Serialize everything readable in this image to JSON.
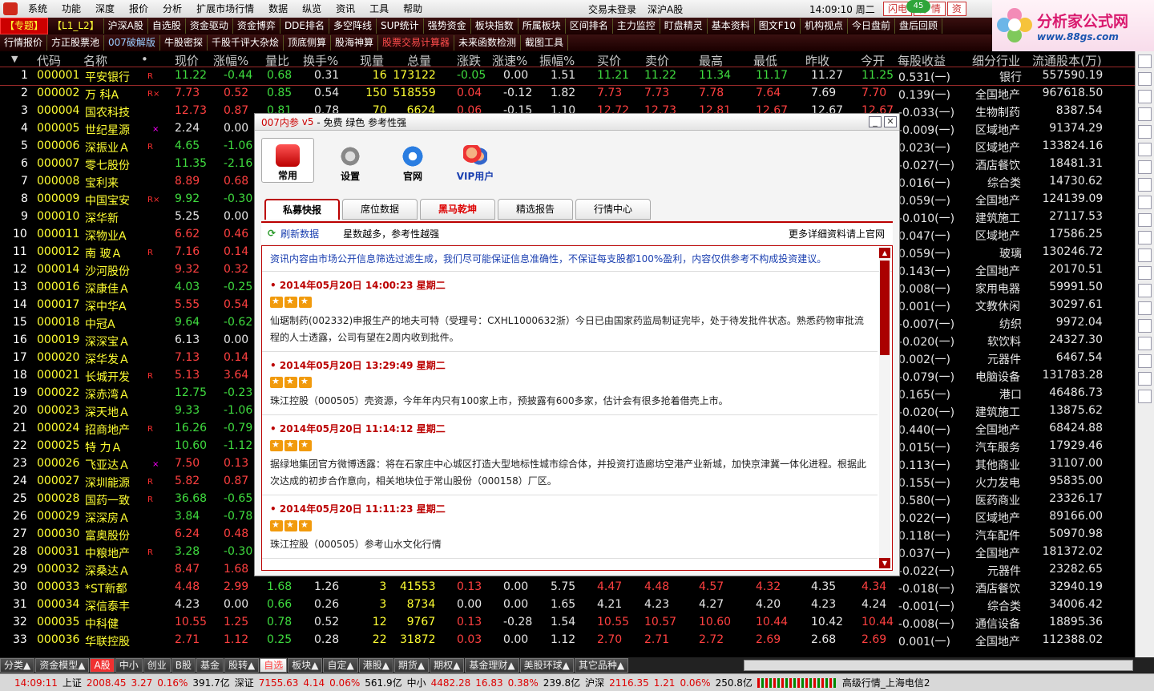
{
  "menubar": {
    "items": [
      "系统",
      "功能",
      "深度",
      "报价",
      "分析",
      "扩展市场行情",
      "数据",
      "纵览",
      "资讯",
      "工具",
      "帮助"
    ],
    "login_status": "交易未登录",
    "market": "深沪A股",
    "clock": "14:09:10 周二",
    "badge": "45",
    "win_buttons": [
      "闪电",
      "行 情",
      "资"
    ]
  },
  "brand": {
    "title": "分析家公式网",
    "url": "www.88gs.com"
  },
  "toolbar1": [
    "【专题】",
    "【L1_L2】",
    "沪深A股",
    "自选股",
    "资金驱动",
    "资金博弈",
    "DDE排名",
    "多空阵线",
    "SUP统计",
    "强势资金",
    "板块指数",
    "所属板块",
    "区间排名",
    "主力监控",
    "盯盘精灵",
    "基本资料",
    "图文F10",
    "机构视点",
    "今日盘前",
    "盘后回顾"
  ],
  "toolbar2": [
    "行情报价",
    "方正股票池",
    "007破解版",
    "牛股密探",
    "千股千评大杂烩",
    "顶底侧算",
    "股海神算",
    "股票交易计算器",
    "未来函数检测",
    "截图工具"
  ],
  "columns": [
    "代码",
    "名称",
    "•",
    "现价",
    "涨幅%",
    "量比",
    "换手%",
    "现量",
    "总量",
    "涨跌",
    "涨速%",
    "振幅%",
    "买价",
    "卖价",
    "最高",
    "最低",
    "昨收",
    "今开",
    "每股收益",
    "细分行业",
    "流通股本(万)"
  ],
  "rows": [
    {
      "i": "1",
      "code": "000001",
      "name": "平安银行",
      "m": "R",
      "price": "11.22",
      "chg": "-0.44",
      "vr": "0.68",
      "turn": "0.31",
      "cur": "16",
      "vol": "173122",
      "d": "-0.05",
      "spd": "0.00",
      "amp": "1.51",
      "bid": "11.21",
      "ask": "11.22",
      "hi": "11.34",
      "lo": "11.17",
      "pre": "11.27",
      "open": "11.25",
      "eps": "0.531(一)",
      "ind": "银行",
      "cap": "557590.19"
    },
    {
      "i": "2",
      "code": "000002",
      "name": "万  科A",
      "m": "R×",
      "price": "7.73",
      "chg": "0.52",
      "vr": "0.85",
      "turn": "0.54",
      "cur": "150",
      "vol": "518559",
      "d": "0.04",
      "spd": "-0.12",
      "amp": "1.82",
      "bid": "7.73",
      "ask": "7.73",
      "hi": "7.78",
      "lo": "7.64",
      "pre": "7.69",
      "open": "7.70",
      "eps": "0.139(一)",
      "ind": "全国地产",
      "cap": "967618.50"
    },
    {
      "i": "3",
      "code": "000004",
      "name": "国农科技",
      "m": "",
      "price": "12.73",
      "chg": "0.87",
      "vr": "0.81",
      "turn": "0.78",
      "cur": "70",
      "vol": "6624",
      "d": "0.06",
      "spd": "-0.15",
      "amp": "1.10",
      "bid": "12.72",
      "ask": "12.73",
      "hi": "12.81",
      "lo": "12.67",
      "pre": "12.67",
      "open": "12.67",
      "eps": "-0.033(一)",
      "ind": "生物制药",
      "cap": "8387.54"
    },
    {
      "i": "4",
      "code": "000005",
      "name": "世纪星源",
      "m": "×",
      "price": "2.24",
      "chg": "0.00",
      "eps": "-0.009(一)",
      "ind": "区域地产",
      "cap": "91374.29"
    },
    {
      "i": "5",
      "code": "000006",
      "name": "深振业Ａ",
      "m": "R",
      "price": "4.65",
      "chg": "-1.06",
      "eps": "0.023(一)",
      "ind": "区域地产",
      "cap": "133824.16"
    },
    {
      "i": "6",
      "code": "000007",
      "name": "零七股份",
      "m": "",
      "price": "11.35",
      "chg": "-2.16",
      "eps": "-0.027(一)",
      "ind": "酒店餐饮",
      "cap": "18481.31"
    },
    {
      "i": "7",
      "code": "000008",
      "name": "宝利来",
      "m": "",
      "price": "8.89",
      "chg": "0.68",
      "eps": "0.016(一)",
      "ind": "综合类",
      "cap": "14730.62"
    },
    {
      "i": "8",
      "code": "000009",
      "name": "中国宝安",
      "m": "R×",
      "price": "9.92",
      "chg": "-0.30",
      "eps": "0.059(一)",
      "ind": "全国地产",
      "cap": "124139.09"
    },
    {
      "i": "9",
      "code": "000010",
      "name": "深华新",
      "m": "",
      "price": "5.25",
      "chg": "0.00",
      "eps": "-0.010(一)",
      "ind": "建筑施工",
      "cap": "27117.53"
    },
    {
      "i": "10",
      "code": "000011",
      "name": "深物业A",
      "m": "",
      "price": "6.62",
      "chg": "0.46",
      "eps": "0.047(一)",
      "ind": "区域地产",
      "cap": "17586.25"
    },
    {
      "i": "11",
      "code": "000012",
      "name": "南  玻Ａ",
      "m": "R",
      "price": "7.16",
      "chg": "0.14",
      "eps": "0.059(一)",
      "ind": "玻璃",
      "cap": "130246.72"
    },
    {
      "i": "12",
      "code": "000014",
      "name": "沙河股份",
      "m": "",
      "price": "9.32",
      "chg": "0.32",
      "eps": "0.143(一)",
      "ind": "全国地产",
      "cap": "20170.51"
    },
    {
      "i": "13",
      "code": "000016",
      "name": "深康佳Ａ",
      "m": "",
      "price": "4.03",
      "chg": "-0.25",
      "eps": "0.008(一)",
      "ind": "家用电器",
      "cap": "59991.50"
    },
    {
      "i": "14",
      "code": "000017",
      "name": "深中华A",
      "m": "",
      "price": "5.55",
      "chg": "0.54",
      "eps": "0.001(一)",
      "ind": "文教休闲",
      "cap": "30297.61"
    },
    {
      "i": "15",
      "code": "000018",
      "name": "中冠A",
      "m": "",
      "price": "9.64",
      "chg": "-0.62",
      "eps": "-0.007(一)",
      "ind": "纺织",
      "cap": "9972.04"
    },
    {
      "i": "16",
      "code": "000019",
      "name": "深深宝Ａ",
      "m": "",
      "price": "6.13",
      "chg": "0.00",
      "eps": "-0.020(一)",
      "ind": "软饮料",
      "cap": "24327.30"
    },
    {
      "i": "17",
      "code": "000020",
      "name": "深华发Ａ",
      "m": "",
      "price": "7.13",
      "chg": "0.14",
      "eps": "0.002(一)",
      "ind": "元器件",
      "cap": "6467.54"
    },
    {
      "i": "18",
      "code": "000021",
      "name": "长城开发",
      "m": "R",
      "price": "5.13",
      "chg": "3.64",
      "eps": "-0.079(一)",
      "ind": "电脑设备",
      "cap": "131783.28"
    },
    {
      "i": "19",
      "code": "000022",
      "name": "深赤湾Ａ",
      "m": "",
      "price": "12.75",
      "chg": "-0.23",
      "eps": "0.165(一)",
      "ind": "港口",
      "cap": "46486.73"
    },
    {
      "i": "20",
      "code": "000023",
      "name": "深天地Ａ",
      "m": "",
      "price": "9.33",
      "chg": "-1.06",
      "eps": "-0.020(一)",
      "ind": "建筑施工",
      "cap": "13875.62"
    },
    {
      "i": "21",
      "code": "000024",
      "name": "招商地产",
      "m": "R",
      "price": "16.26",
      "chg": "-0.79",
      "eps": "0.440(一)",
      "ind": "全国地产",
      "cap": "68424.88"
    },
    {
      "i": "22",
      "code": "000025",
      "name": "特  力Ａ",
      "m": "",
      "price": "10.60",
      "chg": "-1.12",
      "eps": "0.015(一)",
      "ind": "汽车服务",
      "cap": "17929.46"
    },
    {
      "i": "23",
      "code": "000026",
      "name": "飞亚达Ａ",
      "m": "×",
      "price": "7.50",
      "chg": "0.13",
      "eps": "0.113(一)",
      "ind": "其他商业",
      "cap": "31107.00"
    },
    {
      "i": "24",
      "code": "000027",
      "name": "深圳能源",
      "m": "R",
      "price": "5.82",
      "chg": "0.87",
      "eps": "0.155(一)",
      "ind": "火力发电",
      "cap": "95835.00"
    },
    {
      "i": "25",
      "code": "000028",
      "name": "国药一致",
      "m": "R",
      "price": "36.68",
      "chg": "-0.65",
      "eps": "0.580(一)",
      "ind": "医药商业",
      "cap": "23326.17"
    },
    {
      "i": "26",
      "code": "000029",
      "name": "深深房Ａ",
      "m": "",
      "price": "3.84",
      "chg": "-0.78",
      "eps": "0.022(一)",
      "ind": "区域地产",
      "cap": "89166.00"
    },
    {
      "i": "27",
      "code": "000030",
      "name": "富奥股份",
      "m": "",
      "price": "6.24",
      "chg": "0.48",
      "eps": "0.118(一)",
      "ind": "汽车配件",
      "cap": "50970.98"
    },
    {
      "i": "28",
      "code": "000031",
      "name": "中粮地产",
      "m": "R",
      "price": "3.28",
      "chg": "-0.30",
      "eps": "0.037(一)",
      "ind": "全国地产",
      "cap": "181372.02"
    },
    {
      "i": "29",
      "code": "000032",
      "name": "深桑达Ａ",
      "m": "",
      "price": "8.47",
      "chg": "1.68",
      "eps": "-0.022(一)",
      "ind": "元器件",
      "cap": "23282.65"
    },
    {
      "i": "30",
      "code": "000033",
      "name": "*ST新都",
      "m": "",
      "price": "4.48",
      "chg": "2.99",
      "vr": "1.68",
      "turn": "1.26",
      "cur": "3",
      "vol": "41553",
      "d": "0.13",
      "spd": "0.00",
      "amp": "5.75",
      "bid": "4.47",
      "ask": "4.48",
      "hi": "4.57",
      "lo": "4.32",
      "pre": "4.35",
      "open": "4.34",
      "eps": "-0.018(一)",
      "ind": "酒店餐饮",
      "cap": "32940.19"
    },
    {
      "i": "31",
      "code": "000034",
      "name": "深信泰丰",
      "m": "",
      "price": "4.23",
      "chg": "0.00",
      "vr": "0.66",
      "turn": "0.26",
      "cur": "3",
      "vol": "8734",
      "d": "0.00",
      "spd": "0.00",
      "amp": "1.65",
      "bid": "4.21",
      "ask": "4.23",
      "hi": "4.27",
      "lo": "4.20",
      "pre": "4.23",
      "open": "4.24",
      "eps": "-0.001(一)",
      "ind": "综合类",
      "cap": "34006.42"
    },
    {
      "i": "32",
      "code": "000035",
      "name": "中科健",
      "m": "",
      "price": "10.55",
      "chg": "1.25",
      "vr": "0.78",
      "turn": "0.52",
      "cur": "12",
      "vol": "9767",
      "d": "0.13",
      "spd": "-0.28",
      "amp": "1.54",
      "bid": "10.55",
      "ask": "10.57",
      "hi": "10.60",
      "lo": "10.44",
      "pre": "10.42",
      "open": "10.44",
      "eps": "-0.008(一)",
      "ind": "通信设备",
      "cap": "18895.36"
    },
    {
      "i": "33",
      "code": "000036",
      "name": "华联控股",
      "m": "",
      "price": "2.71",
      "chg": "1.12",
      "vr": "0.25",
      "turn": "0.28",
      "cur": "22",
      "vol": "31872",
      "d": "0.03",
      "spd": "0.00",
      "amp": "1.12",
      "bid": "2.70",
      "ask": "2.71",
      "hi": "2.72",
      "lo": "2.69",
      "pre": "2.68",
      "open": "2.69",
      "eps": "0.001(一)",
      "ind": "全国地产",
      "cap": "112388.02"
    }
  ],
  "bottom_tabs": [
    "分类▲",
    "资金模型▲",
    "A股",
    "中小",
    "创业",
    "B股",
    "基金",
    "股转▲",
    "自选",
    "板块▲",
    "自定▲",
    "港股▲",
    "期货▲",
    "期权▲",
    "基金理财▲",
    "美股环球▲",
    "其它品种▲"
  ],
  "statusbar": {
    "time": "14:09:11",
    "sh_label": "上证",
    "sh": "2008.45",
    "sh_chg": "3.27",
    "sh_pct": "0.16%",
    "sh_amt": "391.7亿",
    "sz_label": "深证",
    "sz": "7155.63",
    "sz_chg": "4.14",
    "sz_pct": "0.06%",
    "sz_amt": "561.9亿",
    "zx_label": "中小",
    "zx": "4482.28",
    "zx_chg": "16.83",
    "zx_pct": "0.38%",
    "zx_amt": "239.8亿",
    "hs_label": "沪深",
    "hs": "2116.35",
    "hs_chg": "1.21",
    "hs_pct": "0.06%",
    "hs_amt": "250.8亿",
    "right": "高级行情_上海电信2"
  },
  "dialog": {
    "title": "007内参",
    "version": "v5",
    "subtitle": "- 免费 绿色 参考性强",
    "icons": [
      "常用",
      "设置",
      "官网",
      "VIP用户"
    ],
    "tabs": [
      "私募快报",
      "席位数据",
      "黑马乾坤",
      "精选报告",
      "行情中心"
    ],
    "refresh": "刷新数据",
    "hint": "星数越多，参考性越强",
    "more": "更多详细资料请上官网",
    "disclaimer": "资讯内容由市场公开信息筛选过滤生成，我们尽可能保证信息准确性，不保证每支股都100%盈利，内容仅供参考不构成投资建议。",
    "entries": [
      {
        "dt": "• 2014年05月20日  14:00:23  星期二",
        "stars": 3,
        "body": "仙琚制药(002332)申报生产的地夫可特（受理号：CXHL1000632浙）今日已由国家药监局制证完毕，处于待发批件状态。熟悉药物审批流程的人士透露，公司有望在2周内收到批件。"
      },
      {
        "dt": "• 2014年05月20日  13:29:49  星期二",
        "stars": 3,
        "body": "珠江控股（000505）壳资源，今年年内只有100家上市，预披露有600多家，估计会有很多抢着借壳上市。"
      },
      {
        "dt": "• 2014年05月20日  11:14:12  星期二",
        "stars": 3,
        "body": "据绿地集团官方微博透露：将在石家庄中心城区打造大型地标性城市综合体，并投资打造廊坊空港产业新城，加快京津冀一体化进程。根据此次达成的初步合作意向，相关地块位于常山股份（000158）厂区。"
      },
      {
        "dt": "• 2014年05月20日  11:11:23  星期二",
        "stars": 3,
        "body": "珠江控股（000505）参考山水文化行情"
      }
    ]
  }
}
